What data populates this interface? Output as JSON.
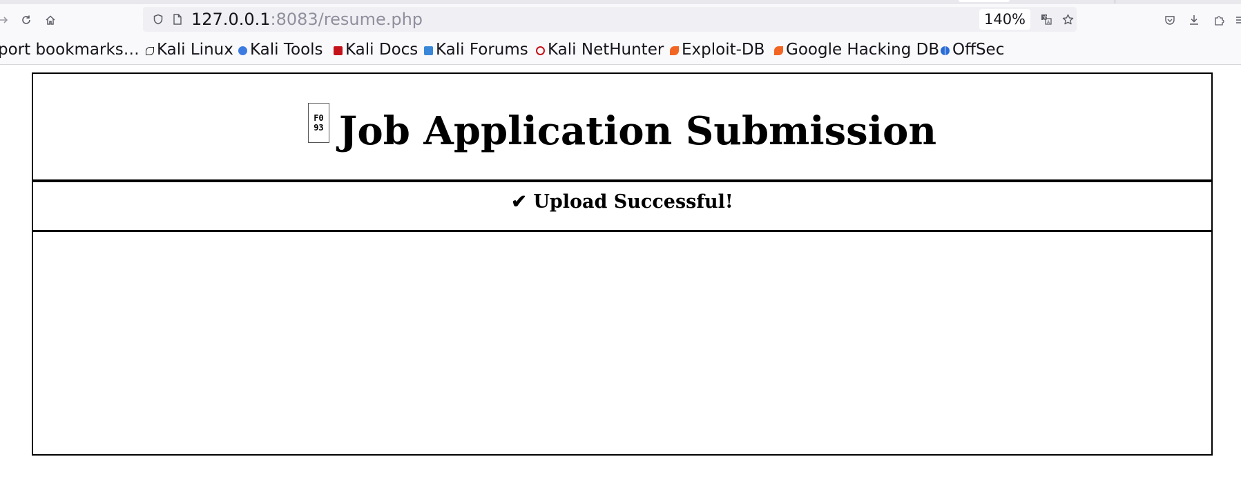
{
  "browser": {
    "url_host": "127.0.0.1",
    "url_rest": ":8083/resume.php",
    "zoom": "140%",
    "icons": {
      "forward": "arrow-right-icon",
      "reload": "reload-icon",
      "home": "home-icon",
      "shield": "shield-icon",
      "page": "page-icon",
      "translate": "translate-icon",
      "bookmark_star": "star-icon",
      "pocket": "pocket-icon",
      "downloads": "download-icon",
      "extensions": "extensions-icon"
    }
  },
  "bookmarks": [
    {
      "label": "port bookmarks…",
      "icon": "none"
    },
    {
      "label": "Kali Linux",
      "icon": "kali-dragon-icon"
    },
    {
      "label": "Kali Tools",
      "icon": "kali-tools-icon"
    },
    {
      "label": "Kali Docs",
      "icon": "kali-docs-icon"
    },
    {
      "label": "Kali Forums",
      "icon": "kali-forums-icon"
    },
    {
      "label": "Kali NetHunter",
      "icon": "kali-nethunter-icon"
    },
    {
      "label": "Exploit-DB",
      "icon": "exploit-db-icon"
    },
    {
      "label": "Google Hacking DB",
      "icon": "ghdb-icon"
    },
    {
      "label": "OffSec",
      "icon": "offsec-icon"
    }
  ],
  "page": {
    "missing_glyph": "F0\n93",
    "title": "Job Application Submission",
    "notice_icon": "✔",
    "notice": "Upload Successful!"
  }
}
